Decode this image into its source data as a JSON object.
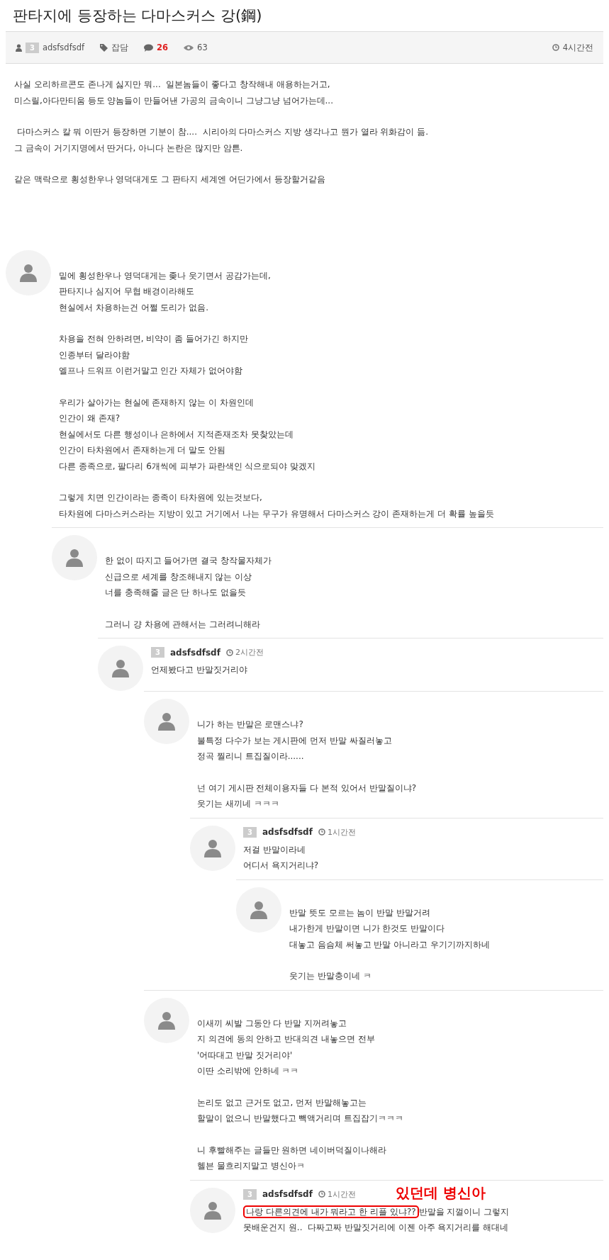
{
  "post": {
    "title": "판타지에 등장하는 다마스커스 강(鋼)",
    "meta": {
      "level": "3",
      "author": "adsfsdfsdf",
      "category": "잡담",
      "comments": "26",
      "views": "63",
      "time": "4시간전"
    },
    "paragraphs": [
      [
        "사실 오리하르콘도 존나게 싫지만 뭐...  일본놈들이 좋다고 창작해내 애용하는거고,",
        "미스릴,아다만티움 등도 양놈들이 만들어낸 가공의 금속이니 그냥그냥 넘어가는데..."
      ],
      [
        " 다마스커스 칼 뭐 이딴거 등장하면 기분이 참....  시리아의 다마스커스 지방 생각나고 뭔가 열라 위화감이 듦.",
        "그 금속이 거기지명에서 딴거다, 아니다 논란은 많지만 암튼."
      ],
      [
        "같은 맥락으로 횡성한우나 영덕대게도 그 판타지 세계엔 어딘가에서 등장할거같음"
      ]
    ]
  },
  "comments": [
    {
      "paragraphs": [
        [
          "밑에 횡성한우나 영덕대게는 좆나 웃기면서 공감가는데,",
          "판타지나 심지어 무협 배경이라해도",
          "현실에서 차용하는건 어쩔 도리가 없음."
        ],
        [
          "차용을 전혀 안하려면, 비약이 좀 들어가긴 하지만",
          "인종부터 달라야함",
          "엘프나 드워프 이런거말고 인간 자체가 없어야함"
        ],
        [
          "우리가 살아가는 현실에 존재하지 않는 이 차원인데",
          "인간이 왜 존재?",
          "현실에서도 다른 행성이나 은하에서 지적존재조차 못찾았는데",
          "인간이 타차원에서 존재하는게 더 말도 안됨",
          "다른 종족으로, 팔다리 6개씩에 피부가 파란색인 식으로되야 맞겠지"
        ],
        [
          "그렇게 치면 인간이라는 종족이 타차원에 있는것보다,",
          "타차원에 다마스커스라는 지방이 있고 거기에서 나는 무구가 유명해서 다마스커스 강이 존재하는게 더 확률 높을듯"
        ]
      ],
      "children": [
        {
          "paragraphs": [
            [
              "한 없이 따지고 들어가면 결국 창작물자체가",
              "신급으로 세계를 창조해내지 않는 이상",
              "너를 충족해줄 글은 단 하나도 없을듯"
            ],
            [
              "그러니 걍 차용에 관해서는 그러려니해라"
            ]
          ],
          "children": [
            {
              "level": "3",
              "author": "adsfsdfsdf",
              "time": "2시간전",
              "paragraphs": [
                [
                  "언제봤다고 반말짓거리야"
                ]
              ],
              "children": [
                {
                  "paragraphs": [
                    [
                      "니가 하는 반말은 로맨스냐?",
                      "불특정 다수가 보는 게시판에 먼저 반말 싸질러놓고",
                      "정곡 찔리니 트집질이라......"
                    ],
                    [
                      "넌 여기 게시판 전체이용자들 다 본적 있어서 반말질이냐?",
                      "웃기는 새끼네 ㅋㅋㅋ"
                    ]
                  ],
                  "children": [
                    {
                      "level": "3",
                      "author": "adsfsdfsdf",
                      "time": "1시간전",
                      "paragraphs": [
                        [
                          "저걸 반말이라네",
                          "어디서 욕지거리냐?"
                        ]
                      ],
                      "children": [
                        {
                          "paragraphs": [
                            [
                              "반말 뜻도 모르는 놈이 반말 반말거려",
                              "내가한게 반말이면 니가 한것도 반말이다",
                              "대놓고 음슴체 써놓고 반말 아니라고 우기기까지하네"
                            ],
                            [
                              "웃기는 반말충이네 ㅋ"
                            ]
                          ]
                        }
                      ]
                    }
                  ]
                },
                {
                  "paragraphs": [
                    [
                      "이새끼 씨발 그동안 다 반말 지꺼려놓고",
                      "지 의견에 동의 안하고 반대의견 내놓으면 전부",
                      "'어따대고 반말 짓거리야'",
                      "이딴 소리밖에 안하네 ㅋㅋ"
                    ],
                    [
                      "논리도 없고 근거도 없고, 먼저 반말해놓고는",
                      "할말이 없으니 반말했다고 빽액거리며 트집잡기ㅋㅋㅋ"
                    ],
                    [
                      "니 후빨해주는 글들만 원하면 네이버덕질이나해라",
                      "헬븐 물흐리지말고 병신아ㅋ"
                    ]
                  ],
                  "children": [
                    {
                      "level": "3",
                      "author": "adsfsdfsdf",
                      "time": "1시간전",
                      "annotation": "있던데 병신아",
                      "paragraphs": [
                        [
                          [
                            {
                              "text": "나랑 다른의견에 내가 뭐라고 한 리플 있냐??",
                              "circled": true
                            },
                            {
                              "text": "반말을 지껄이니 그렇지",
                              "circled": false
                            }
                          ],
                          "못배운건지 원..  다짜고짜 반말짓거리에 이젠 아주 욕지거리를 해대네"
                        ]
                      ]
                    }
                  ]
                }
              ]
            }
          ]
        }
      ]
    }
  ]
}
